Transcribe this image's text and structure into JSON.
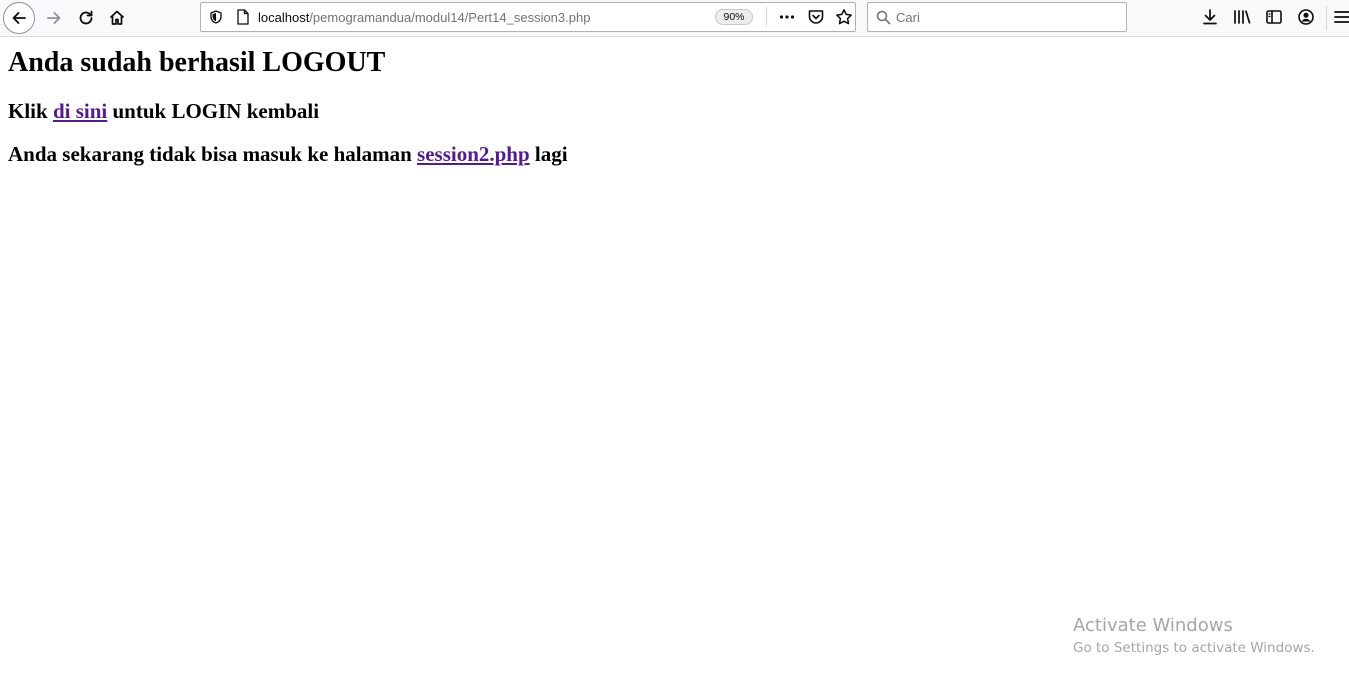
{
  "toolbar": {
    "url": {
      "host": "localhost",
      "path": "/pemogramandua/modul14/Pert14_session3.php"
    },
    "zoom": "90%",
    "search": {
      "placeholder": "Cari"
    }
  },
  "page": {
    "heading": "Anda sudah berhasil LOGOUT",
    "line1": {
      "before": "Klik ",
      "link": "di sini",
      "after": " untuk LOGIN kembali"
    },
    "line2": {
      "before": "Anda sekarang tidak bisa masuk ke halaman ",
      "link": "session2.php",
      "after": " lagi"
    }
  },
  "watermark": {
    "title": "Activate Windows",
    "subtitle": "Go to Settings to activate Windows."
  },
  "colors": {
    "link_visited": "#551a8b",
    "toolbar_bg": "#f9f9fb"
  }
}
